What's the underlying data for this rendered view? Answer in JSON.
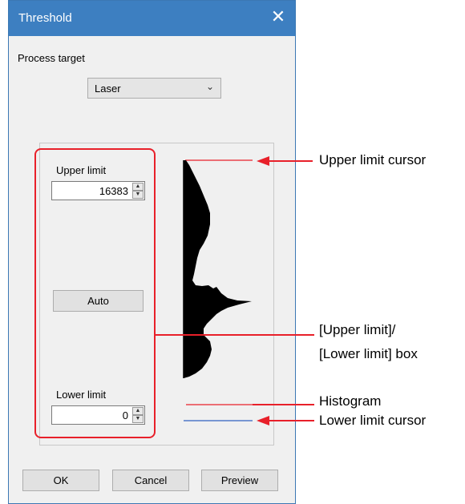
{
  "dialog": {
    "title": "Threshold",
    "close_icon": "close-icon",
    "process_target_label": "Process target",
    "process_target_value": "Laser",
    "upper_limit_label": "Upper limit",
    "upper_limit_value": "16383",
    "auto_label": "Auto",
    "lower_limit_label": "Lower limit",
    "lower_limit_value": "0",
    "ok_label": "OK",
    "cancel_label": "Cancel",
    "preview_label": "Preview"
  },
  "callouts": {
    "upper_cursor": "Upper limit cursor",
    "box_line1": "[Upper limit]/",
    "box_line2": "[Lower limit] box",
    "histogram": "Histogram",
    "lower_cursor": "Lower limit cursor"
  },
  "colors": {
    "titlebar": "#3d7fc1",
    "highlight": "#e8202a",
    "upper_cursor": "#e8202a",
    "lower_cursor": "#3060c0"
  }
}
